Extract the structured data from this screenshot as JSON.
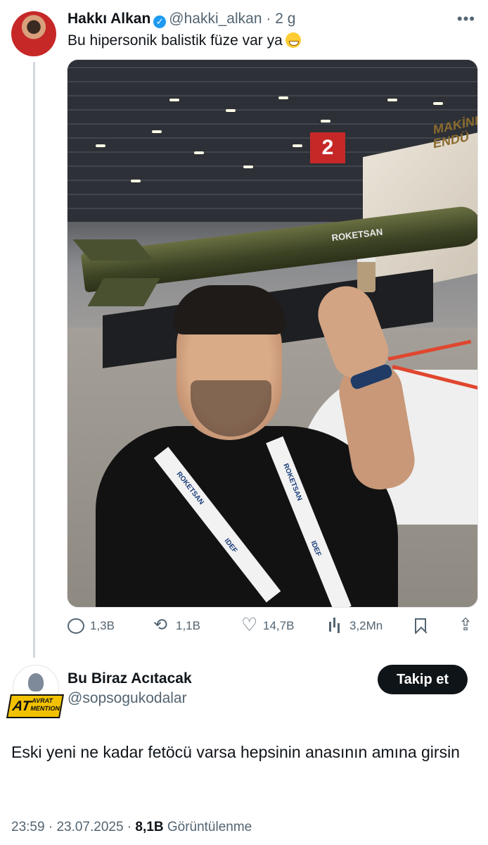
{
  "tweet": {
    "author_name": "Hakkı Alkan",
    "author_handle": "@hakki_alkan",
    "separator": "·",
    "time_ago": "2 g",
    "more_label": "•••",
    "text": "Bu hipersonik balistik füze var ya",
    "emoji": "sweat-smile-emoji",
    "image": {
      "booth_sign": "MAKİNE\nENDÜ",
      "hall_sign": "2",
      "missile_label": "ROKETSAN",
      "lanyard_texts": [
        "ROKETSAN",
        "IDEF",
        "ROKETSAN",
        "IDEF"
      ]
    },
    "stats": {
      "replies": "1,3B",
      "retweets": "1,1B",
      "likes": "14,7B",
      "views": "3,2Mn"
    }
  },
  "reply": {
    "author_name": "Bu Biraz Acıtacak",
    "author_handle": "@sopsogukodalar",
    "avatar_logo_text": "AT",
    "avatar_logo_sub": "AVRAT\nMENTION",
    "follow_label": "Takip et",
    "text": "Eski yeni ne kadar fetöcü varsa hepsinin anasının amına girsin",
    "time": "23:59",
    "date": "23.07.2025",
    "separator": "·",
    "views_count": "8,1B",
    "views_label": "Görüntülenme"
  },
  "colors": {
    "accent": "#1d9bf0",
    "text": "#0f1419",
    "muted": "#536471"
  }
}
